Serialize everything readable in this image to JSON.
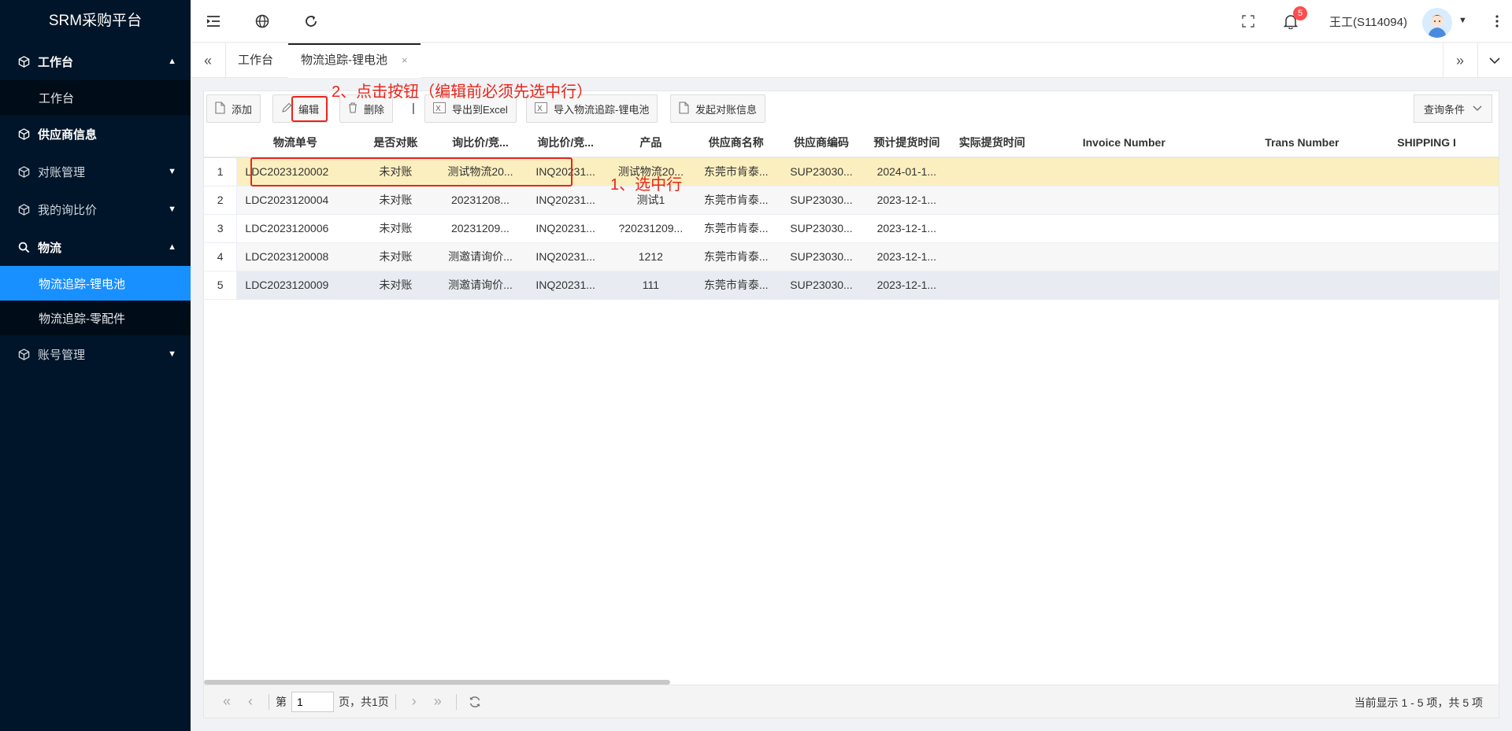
{
  "app": {
    "title": "SRM采购平台"
  },
  "sidebar": {
    "items": [
      {
        "label": "工作台"
      },
      {
        "sub_label": "工作台"
      },
      {
        "label": "供应商信息"
      },
      {
        "label": "对账管理"
      },
      {
        "label": "我的询比价"
      },
      {
        "label": "物流"
      },
      {
        "sub_label": "物流追踪-锂电池"
      },
      {
        "sub_label": "物流追踪-零配件"
      },
      {
        "label": "账号管理"
      }
    ]
  },
  "header": {
    "notification_count": "5",
    "user_name": "王工(S114094)"
  },
  "tabs": [
    {
      "label": "工作台"
    },
    {
      "label": "物流追踪-锂电池",
      "close": "×"
    }
  ],
  "toolbar": {
    "add": "添加",
    "edit": "编辑",
    "delete": "删除",
    "divider": "|",
    "export": "导出到Excel",
    "import": "导入物流追踪-锂电池",
    "reconcile": "发起对账信息",
    "query": "查询条件"
  },
  "table": {
    "columns": [
      "物流单号",
      "是否对账",
      "询比价/竞...",
      "询比价/竞...",
      "产品",
      "供应商名称",
      "供应商编码",
      "预计提货时间",
      "实际提货时间",
      "Invoice Number",
      "Trans Number",
      "SHIPPING I"
    ],
    "rows": [
      {
        "n": "1",
        "cells": [
          "LDC2023120002",
          "未对账",
          "测试物流20...",
          "INQ20231...",
          "测试物流20...",
          "东莞市肯泰...",
          "SUP23030...",
          "2024-01-1...",
          "",
          "",
          "",
          ""
        ]
      },
      {
        "n": "2",
        "cells": [
          "LDC2023120004",
          "未对账",
          "20231208...",
          "INQ20231...",
          "测试1",
          "东莞市肯泰...",
          "SUP23030...",
          "2023-12-1...",
          "",
          "",
          "",
          ""
        ]
      },
      {
        "n": "3",
        "cells": [
          "LDC2023120006",
          "未对账",
          "20231209...",
          "INQ20231...",
          "?20231209...",
          "东莞市肯泰...",
          "SUP23030...",
          "2023-12-1...",
          "",
          "",
          "",
          ""
        ]
      },
      {
        "n": "4",
        "cells": [
          "LDC2023120008",
          "未对账",
          "测邀请询价...",
          "INQ20231...",
          "1212",
          "东莞市肯泰...",
          "SUP23030...",
          "2023-12-1...",
          "",
          "",
          "",
          ""
        ]
      },
      {
        "n": "5",
        "cells": [
          "LDC2023120009",
          "未对账",
          "测邀请询价...",
          "INQ20231...",
          "111",
          "东莞市肯泰...",
          "SUP23030...",
          "2023-12-1...",
          "",
          "",
          "",
          ""
        ]
      }
    ]
  },
  "pager": {
    "page_prefix": "第",
    "page_value": "1",
    "page_suffix": "页，共1页",
    "summary": "当前显示 1 - 5 项，共 5 项"
  },
  "annotations": {
    "step1": "1、选中行",
    "step2": "2、点击按钮（编辑前必须先选中行）"
  },
  "colors": {
    "sidebar_bg": "#001529",
    "active_menu": "#1890ff",
    "selected_row": "#fcefbf",
    "annotation": "#e8251a",
    "badge": "#ff4d4f"
  }
}
